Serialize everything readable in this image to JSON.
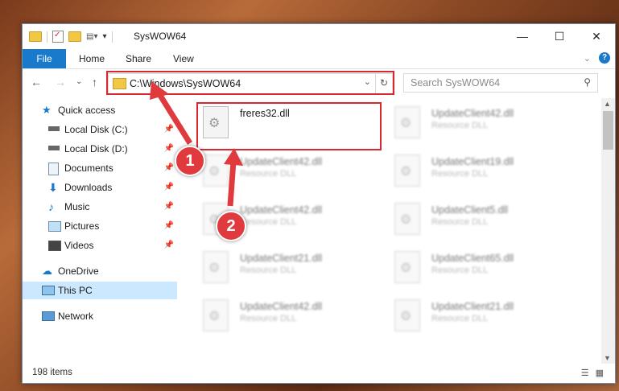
{
  "window": {
    "title": "SysWOW64",
    "controls": [
      "—",
      "☐",
      "✕"
    ]
  },
  "ribbon": {
    "tabs": [
      "File",
      "Home",
      "Share",
      "View"
    ]
  },
  "address": {
    "path": "C:\\Windows\\SysWOW64",
    "search_placeholder": "Search SysWOW64"
  },
  "sidebar": {
    "items": [
      {
        "label": "Quick access",
        "icon": "star-icon",
        "pinned": false
      },
      {
        "label": "Local Disk (C:)",
        "icon": "drive-icon",
        "pinned": true
      },
      {
        "label": "Local Disk (D:)",
        "icon": "drive-icon",
        "pinned": true
      },
      {
        "label": "Documents",
        "icon": "documents-icon",
        "pinned": true
      },
      {
        "label": "Downloads",
        "icon": "download-icon",
        "pinned": true
      },
      {
        "label": "Music",
        "icon": "music-icon",
        "pinned": true
      },
      {
        "label": "Pictures",
        "icon": "pictures-icon",
        "pinned": true
      },
      {
        "label": "Videos",
        "icon": "videos-icon",
        "pinned": true
      },
      {
        "label": "OneDrive",
        "icon": "cloud-icon",
        "pinned": false
      },
      {
        "label": "This PC",
        "icon": "pc-icon",
        "pinned": false
      },
      {
        "label": "Network",
        "icon": "network-icon",
        "pinned": false
      }
    ]
  },
  "files": [
    {
      "name": "freres32.dll",
      "type": ""
    },
    {
      "name": "UpdateClient42.dll",
      "type": "Resource DLL"
    },
    {
      "name": "UpdateClient42.dll",
      "type": "Resource DLL"
    },
    {
      "name": "UpdateClient19.dll",
      "type": "Resource DLL"
    },
    {
      "name": "UpdateClient42.dll",
      "type": "Resource DLL"
    },
    {
      "name": "UpdateClient5.dll",
      "type": "Resource DLL"
    },
    {
      "name": "UpdateClient21.dll",
      "type": "Resource DLL"
    },
    {
      "name": "UpdateClient65.dll",
      "type": "Resource DLL"
    },
    {
      "name": "UpdateClient42.dll",
      "type": "Resource DLL"
    },
    {
      "name": "UpdateClient21.dll",
      "type": "Resource DLL"
    }
  ],
  "status": {
    "item_count": "198 items"
  },
  "callouts": [
    "1",
    "2"
  ],
  "colors": {
    "accent": "#1979ca",
    "highlight": "#d8282f",
    "selected": "#cce8ff"
  }
}
